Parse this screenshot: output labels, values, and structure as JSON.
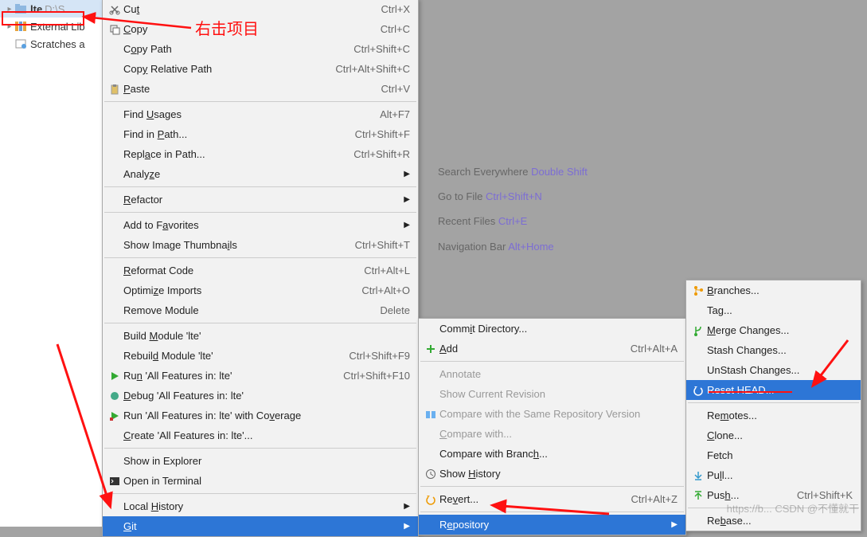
{
  "tree": {
    "project_label": "lte",
    "project_path": "D:\\S...",
    "ext_lib": "External Lib",
    "scratches": "Scratches a"
  },
  "hints": {
    "search": "Search Everywhere",
    "search_k": "Double Shift",
    "goto": "Go to File",
    "goto_k": "Ctrl+Shift+N",
    "recent": "Recent Files",
    "recent_k": "Ctrl+E",
    "nav": "Navigation Bar",
    "nav_k": "Alt+Home"
  },
  "menu1": [
    {
      "icon": "cut",
      "label": "Cu<u>t</u>",
      "short": "Ctrl+X"
    },
    {
      "icon": "copy",
      "label": "<u>C</u>opy",
      "short": "Ctrl+C"
    },
    {
      "icon": "",
      "label": "C<u>o</u>py Path",
      "short": "Ctrl+Shift+C"
    },
    {
      "icon": "",
      "label": "Cop<u>y</u> Relative Path",
      "short": "Ctrl+Alt+Shift+C"
    },
    {
      "icon": "paste",
      "label": "<u>P</u>aste",
      "short": "Ctrl+V"
    },
    {
      "sep": true
    },
    {
      "icon": "",
      "label": "Find <u>U</u>sages",
      "short": "Alt+F7"
    },
    {
      "icon": "",
      "label": "Find in <u>P</u>ath...",
      "short": "Ctrl+Shift+F"
    },
    {
      "icon": "",
      "label": "Repl<u>a</u>ce in Path...",
      "short": "Ctrl+Shift+R"
    },
    {
      "icon": "",
      "label": "Analy<u>z</u>e",
      "arrow": true
    },
    {
      "sep": true
    },
    {
      "icon": "",
      "label": "<u>R</u>efactor",
      "arrow": true
    },
    {
      "sep": true
    },
    {
      "icon": "",
      "label": "Add to F<u>a</u>vorites",
      "arrow": true
    },
    {
      "icon": "",
      "label": "Show Image Thumbna<u>i</u>ls",
      "short": "Ctrl+Shift+T"
    },
    {
      "sep": true
    },
    {
      "icon": "",
      "label": "<u>R</u>eformat Code",
      "short": "Ctrl+Alt+L"
    },
    {
      "icon": "",
      "label": "Optimi<u>z</u>e Imports",
      "short": "Ctrl+Alt+O"
    },
    {
      "icon": "",
      "label": "Remove Module",
      "short": "Delete"
    },
    {
      "sep": true
    },
    {
      "icon": "",
      "label": "Build <u>M</u>odule 'lte'"
    },
    {
      "icon": "",
      "label": "Rebuil<u>d</u> Module 'lte'",
      "short": "Ctrl+Shift+F9"
    },
    {
      "icon": "run",
      "label": "Ru<u>n</u> 'All Features in: lte'",
      "short": "Ctrl+Shift+F10"
    },
    {
      "icon": "debug",
      "label": "<u>D</u>ebug 'All Features in: lte'"
    },
    {
      "icon": "cover",
      "label": "Run 'All Features in: lte' with Co<u>v</u>erage"
    },
    {
      "icon": "",
      "label": "<u>C</u>reate 'All Features in: lte'..."
    },
    {
      "sep": true
    },
    {
      "icon": "",
      "label": "Show in Explorer"
    },
    {
      "icon": "term",
      "label": "Open in Terminal"
    },
    {
      "sep": true
    },
    {
      "icon": "",
      "label": "Local <u>H</u>istory",
      "arrow": true
    },
    {
      "icon": "",
      "label": "<u>G</u>it",
      "arrow": true,
      "sel": true
    }
  ],
  "menu2": [
    {
      "icon": "",
      "label": "Comm<u>i</u>t Directory..."
    },
    {
      "icon": "add",
      "label": "<u>A</u>dd",
      "short": "Ctrl+Alt+A"
    },
    {
      "sep": true
    },
    {
      "icon": "",
      "label": "Annotate",
      "dis": true
    },
    {
      "icon": "",
      "label": "Show Current Revision",
      "dis": true
    },
    {
      "icon": "diff",
      "label": "Compare with the Same Repository Version",
      "dis": true
    },
    {
      "icon": "",
      "label": "<u>C</u>ompare with...",
      "dis": true
    },
    {
      "icon": "",
      "label": "Compare with Branc<u>h</u>..."
    },
    {
      "icon": "clock",
      "label": "Show <u>H</u>istory"
    },
    {
      "sep": true
    },
    {
      "icon": "revert",
      "label": "Re<u>v</u>ert...",
      "short": "Ctrl+Alt+Z"
    },
    {
      "sep": true
    },
    {
      "icon": "",
      "label": "R<u>e</u>pository",
      "arrow": true,
      "sel": true
    }
  ],
  "menu3": [
    {
      "icon": "branch",
      "label": "<u>B</u>ranches..."
    },
    {
      "icon": "",
      "label": "Tag..."
    },
    {
      "icon": "merge",
      "label": "<u>M</u>erge Changes..."
    },
    {
      "icon": "",
      "label": "Stash Changes..."
    },
    {
      "icon": "",
      "label": "UnStash Changes..."
    },
    {
      "icon": "reset",
      "label": "Reset HEAD...",
      "sel": true
    },
    {
      "sep": true
    },
    {
      "icon": "",
      "label": "Re<u>m</u>otes..."
    },
    {
      "icon": "",
      "label": "<u>C</u>lone..."
    },
    {
      "icon": "",
      "label": "Fetch"
    },
    {
      "icon": "pull",
      "label": "Pu<u>l</u>l..."
    },
    {
      "icon": "push",
      "label": "Pus<u>h</u>...",
      "short": "Ctrl+Shift+K"
    },
    {
      "sep": true
    },
    {
      "icon": "",
      "label": "Re<u>b</u>ase..."
    }
  ],
  "annotation": "右击项目",
  "watermark": "https://b...  CSDN @不懂就干"
}
